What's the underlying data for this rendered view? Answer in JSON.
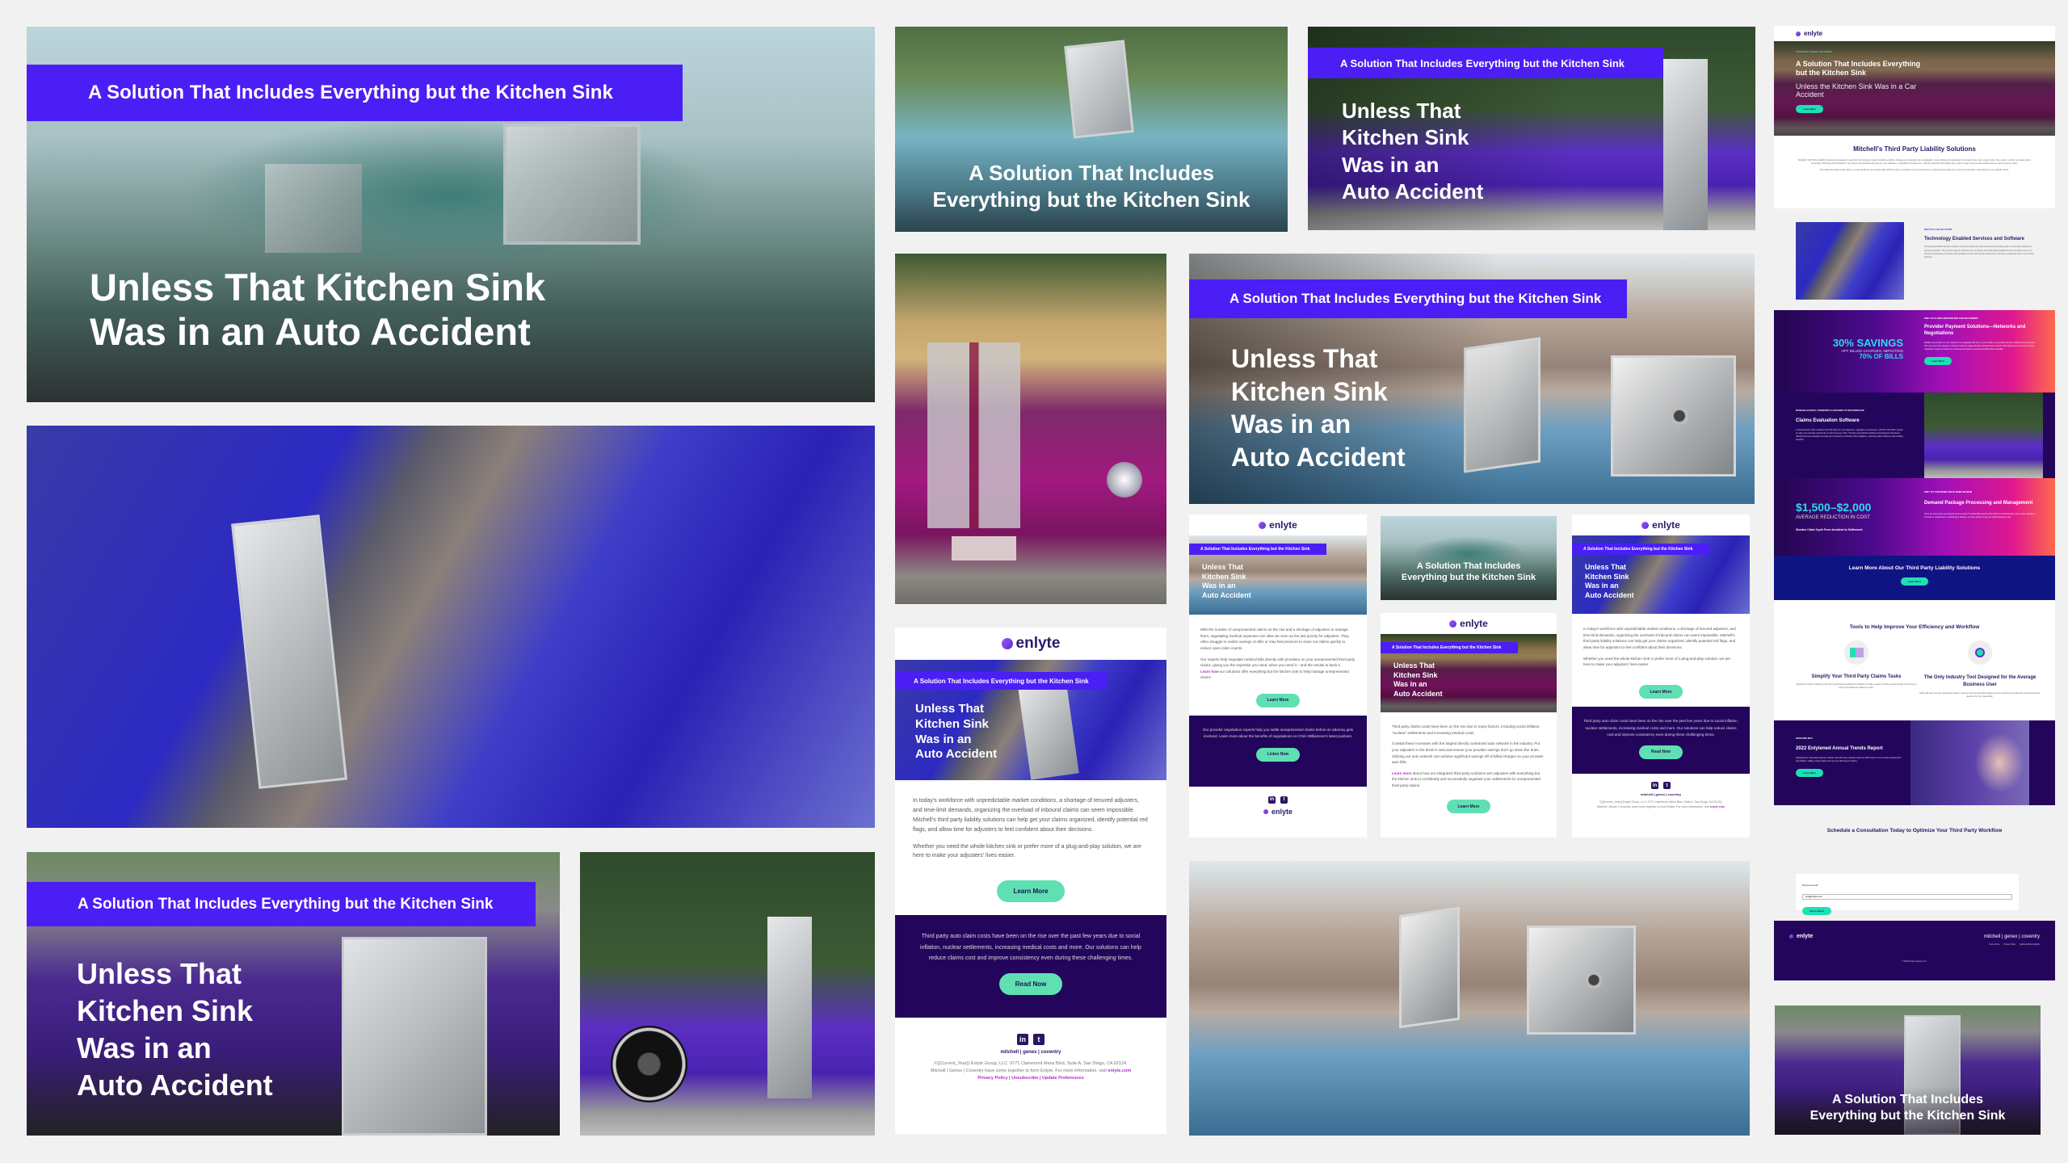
{
  "tagline": "A Solution That Includes Everything but the Kitchen Sink",
  "headline_two_line": [
    "Unless That Kitchen Sink",
    "Was in an Auto Accident"
  ],
  "headline_four_line": [
    "Unless That",
    "Kitchen Sink",
    "Was in an",
    "Auto Accident"
  ],
  "caption_two_line": [
    "A Solution That Includes",
    "Everything but the Kitchen Sink"
  ],
  "brand": {
    "name": "enlyte",
    "accent": "#4b1ef5",
    "cta_color": "#5fe0b3",
    "dark_color": "#23065c",
    "link_color": "#b22bc9"
  },
  "emails": {
    "a": {
      "paragraphs": [
        "With the number of unrepresented claims on the rise and a shortage of adjusters to manage them, negotiating medical expenses can often be seen as the last priority for adjusters. They often struggle to realize savings on bills or may feel pressure to close out claims quickly to reduce open claim counts.",
        "Our experts help negotiate medical bills directly with providers on your unrepresented third party claims, giving you the expertise you need, when you need it – and the results to back it."
      ],
      "link_text": "Learn how",
      "link_rest": " our solutions offer everything but the kitchen sink to help manage unrepresented claims.",
      "cta": "Learn More",
      "dark_text": "Our provider negotiation experts help you settle unrepresented claims before an attorney gets involved. Learn more about the benefits of negotiations on Chris Williamson's latest podcast.",
      "dark_cta": "Listen Now"
    },
    "b": {
      "paragraphs": [
        "Third party claims costs have been on the rise due to many factors, including social inflation, \"nuclear\" settlements and increasing medical costs.",
        "Combat these increases with the largest directly contracted auto network in the industry. Put your adjusters in the driver's seat and ensure your provider savings don't go down the drain. Utilizing our auto network can achieve significant savings off of billed charges on your provider auto bills."
      ],
      "link_text": "Learn more",
      "link_rest": " about how our integrated third party solutions arm adjusters with everything but the kitchen sink to confidently and successfully negotiate your settlements for unrepresented third party claims.",
      "cta": "Learn More"
    },
    "c": {
      "paragraphs": [
        "In today's workforce with unpredictable market conditions, a shortage of tenured adjusters, and time-limit demands, organizing the overload of inbound claims can seem impossible. Mitchell's third party liability solutions can help get your claims organized, identify potential red flags, and allow time for adjusters to feel confident about their decisions.",
        "Whether you need the whole kitchen sink or prefer more of a plug-and-play solution, we are here to make your adjusters' lives easier."
      ],
      "cta": "Learn More",
      "dark_text": "Third party auto claim costs have been on the rise over the past few years due to social inflation, nuclear settlements, increasing medical costs and more. Our solutions can help reduce claims cost and improve consistency even during these challenging times.",
      "dark_cta": "Read Now"
    },
    "footer": {
      "social": [
        "in",
        "t"
      ],
      "brands": "mitchell | genex | coventry",
      "address": "©{{Current_Year}} Enlyte Group, LLC. 9771 Clairemont Mesa Blvd, Suite A, San Diego, CA 92124.",
      "merger": "Mitchell | Genex | Coventry have come together to form Enlyte. For more information, visit ",
      "site": "enlyte.com",
      "links": [
        "Privacy Policy",
        "Unsubscribe",
        "Update Preferences"
      ]
    }
  },
  "landing": {
    "eyebrow": "THIRD PARTY LIABILITY SOLUTIONS",
    "hero_title": "A Solution That Includes Everything but the Kitchen Sink",
    "hero_sub": "Unless the Kitchen Sink Was in a Car Accident",
    "hero_cta": "Learn More",
    "intro_title": "Mitchell's Third Party Liability Solutions",
    "intro_p1": "Mitchell's Third Party Liability Solutions are designed to optimize the third party claims handling workflow, bringing your adjusters the investigation, injury, liability and negotiation information they need, exactly when they need it, so they can settle claims accurately, efficiently and consistently. Our end-to-end solutions can help arm your adjusters—regardless of experience—with the tools and information they need to make more accurate settlements on each and every claim.",
    "intro_p2": "We understand that no two claims, nor two workflows, are exactly alike. Which is why our solutions can be accessed on a plug-and-play basis or an end-to-end solution—depending on your specific needs.",
    "tech_eyebrow": "BEST IN CLASS SOLUTIONS",
    "tech_title": "Technology Enabled Services and Software",
    "tech_text": "Technology Enabled Services combine our best-in-class bill review and claims technology with our extensive expertise in process execution. The result is superior outcomes for our clients. Our Technology Enabled Services provide end-to-end document processing, bill review and specialty services with speed and accuracy, returning exceptional value to our clients' business.",
    "stat1_big": "30% SAVINGS",
    "stat1_mid": "OFF BILLED CHARGES, IMPACTING",
    "stat1_small": "70% OF BILLS",
    "ppay_eyebrow": "DON'T LET CLAIMS CONFUSION SINK YOUR SETTLEMENTS",
    "ppay_title": "Provider Payment Solutions—Networks and Negotiations",
    "ppay_text": "Whether the provider is in our network, or we negotiate with them on your behalf—our provider payment solutions ensure that you don't pay more than expected. Using the industry's largest directly contracted auto network, while tapping into our team of expert negotiators, helps you settle your unrepresented claims as quickly and efficiently as possible.",
    "ppay_cta": "Learn More",
    "ces_eyebrow": "INCREASE ACCURACY, CONSISTENCY & EFFICIENCY IN YOUR WORKFLOW",
    "ces_title": "Claims Evaluation Software",
    "ces_text": "A comprehensive claim evaluation tool that helps arm your adjusters—regardless of experience—with the information needed to make more accurate settlements on each and every claim. Through a streamlined workflow and integrated environment, ClaimIQ improves evaluation accuracy and consistency, and helps reduce litigation—improving claims efficiency and handling expertise.",
    "stat2_big": "$1,500–$2,000",
    "stat2_mid": "AVERAGE REDUCTION IN COST",
    "stat2_small": "Shorten Claim Cycle From Accident to Settlement",
    "demand_eyebrow": "DON'T LET YOUR WORKFLOW GO DOWN THE DRAIN",
    "demand_title": "Demand Package Processing and Management",
    "demand_text": "There are times when you may just need a review of medical bills and times that call for a comprehensive nurse review. Whether it is simple or complicated, or something in between, we have options to get you exactly what you need.",
    "learn_title": "Learn More About Our Third Party Liability Solutions",
    "learn_cta": "Learn More",
    "tools_title": "Tools to Help Improve Your Efficiency and Workflow",
    "tool1_title": "Simplify Your Third Party Claims Tasks",
    "tool1_text": "Simplify the decision making process with a cloud-based workspace for adjusters to make it easier to submit requests and get a full picture of injuries and treatments related to a claim.",
    "tool2_title": "The Only Industry Tool Designed for the Average Business User",
    "tool2_text": "Easily drill down into your organization's data on demand, deriving actionable insights and more effectively and efficiently answering business questions for your organization.",
    "report_eyebrow": "NAVIGATING NEXT",
    "report_title": "2022 Enlytened Annual Trends Report",
    "report_text": "Navigating the road ahead requires a holistic view with deep expertise. Read our 2022 report for one-of-a-kind insight about how inflation, staffing, supply chains and more are affecting our industry.",
    "report_cta": "Learn More",
    "consult_title": "Schedule a Consultation Today to Optimize Your Third Party Workflow",
    "email_label": "Business Email*",
    "email_value": "test@enlyte.com",
    "form_cta": "Get in touch",
    "footer_brands": "mitchell | genex | coventry",
    "footer_links": [
      "Terms of Use",
      "Privacy Policy",
      "California Privacy Rights"
    ],
    "footer_copy": "© 2023 Enlyte Group, LLC."
  }
}
